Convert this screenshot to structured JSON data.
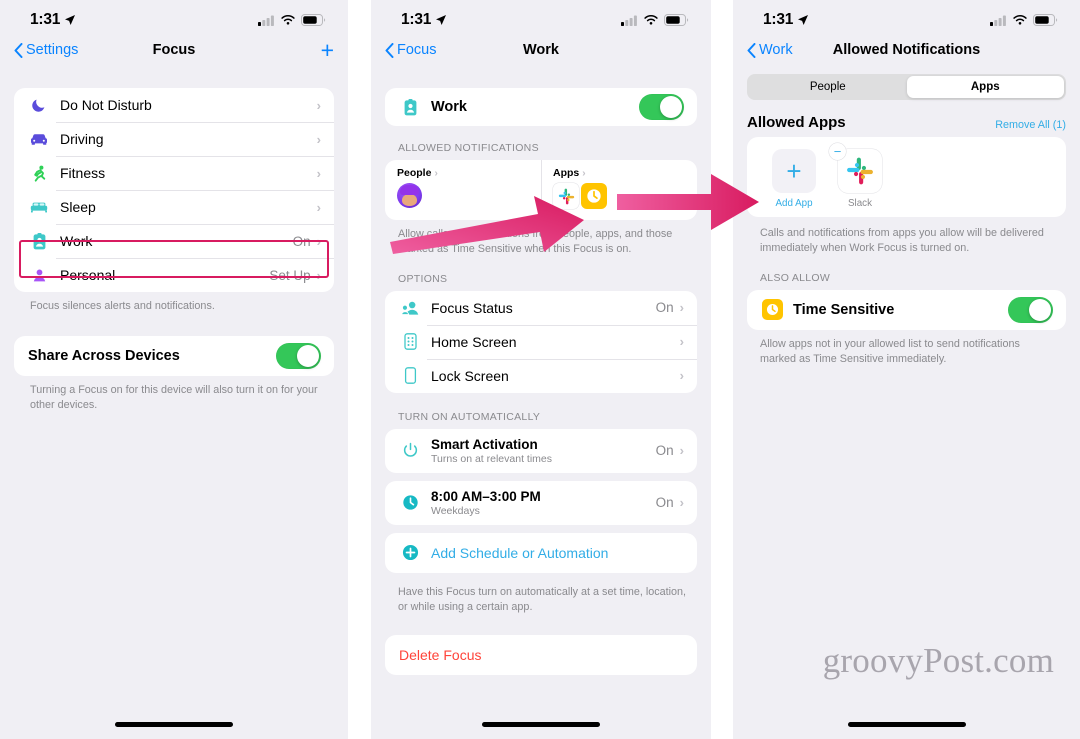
{
  "statusbar": {
    "time": "1:31",
    "location_icon": "location-arrow-icon",
    "cellular_icon": "cellular-bars-icon",
    "wifi_icon": "wifi-icon",
    "battery_icon": "battery-icon"
  },
  "watermark": "groovyPost.com",
  "colors": {
    "accent_blue": "#0a84ff",
    "accent_teal": "#32ade6",
    "toggle_green": "#34c759",
    "danger_red": "#ff443a",
    "highlight_pink": "#d81b60",
    "arrow_pink": "#e8357f"
  },
  "panel1": {
    "nav": {
      "back_label": "Settings",
      "title": "Focus",
      "add_icon": "plus-icon"
    },
    "focus_list": [
      {
        "icon": "moon-icon",
        "label": "Do Not Disturb",
        "value": "",
        "chevron": "›"
      },
      {
        "icon": "car-icon",
        "label": "Driving",
        "value": "",
        "chevron": "›"
      },
      {
        "icon": "running-person-icon",
        "label": "Fitness",
        "value": "",
        "chevron": "›"
      },
      {
        "icon": "bed-icon",
        "label": "Sleep",
        "value": "",
        "chevron": "›"
      },
      {
        "icon": "id-badge-icon",
        "label": "Work",
        "value": "On",
        "chevron": "›"
      },
      {
        "icon": "person-icon",
        "label": "Personal",
        "value": "Set Up",
        "chevron": "›"
      }
    ],
    "focus_footnote": "Focus silences alerts and notifications.",
    "share": {
      "label": "Share Across Devices",
      "enabled": true
    },
    "share_footnote": "Turning a Focus on for this device will also turn it on for your other devices."
  },
  "panel2": {
    "nav": {
      "back_label": "Focus",
      "title": "Work"
    },
    "work_toggle": {
      "icon": "id-badge-icon",
      "label": "Work",
      "enabled": true
    },
    "allowed_header": "ALLOWED NOTIFICATIONS",
    "allowed_people": {
      "title": "People",
      "chevron": "›",
      "avatar": "memoji-avatar"
    },
    "allowed_apps": {
      "title": "Apps",
      "chevron": "›",
      "icons": [
        "slack-icon",
        "time-sensitive-clock-icon"
      ]
    },
    "allowed_footnote": "Allow calls and notifications from people, apps, and those marked as Time Sensitive when this Focus is on.",
    "options_header": "OPTIONS",
    "options": [
      {
        "icon": "focus-status-icon",
        "label": "Focus Status",
        "value": "On",
        "chevron": "›"
      },
      {
        "icon": "home-screen-icon",
        "label": "Home Screen",
        "value": "",
        "chevron": "›"
      },
      {
        "icon": "lock-screen-icon",
        "label": "Lock Screen",
        "value": "",
        "chevron": "›"
      }
    ],
    "auto_header": "TURN ON AUTOMATICALLY",
    "automations": [
      {
        "icon": "power-icon",
        "label": "Smart Activation",
        "sub": "Turns on at relevant times",
        "value": "On",
        "chevron": "›"
      },
      {
        "icon": "clock-icon",
        "label": "8:00 AM–3:00 PM",
        "sub": "Weekdays",
        "value": "On",
        "chevron": "›"
      }
    ],
    "add_schedule": {
      "icon": "plus-circle-icon",
      "label": "Add Schedule or Automation"
    },
    "auto_footnote": "Have this Focus turn on automatically at a set time, location, or while using a certain app.",
    "delete": {
      "label": "Delete Focus"
    }
  },
  "panel3": {
    "nav": {
      "back_label": "Work",
      "title": "Allowed Notifications"
    },
    "segments": [
      {
        "label": "People",
        "active": false
      },
      {
        "label": "Apps",
        "active": true
      }
    ],
    "section": {
      "title": "Allowed Apps",
      "action": "Remove All (1)"
    },
    "apps": [
      {
        "tile": "add",
        "icon": "plus-icon",
        "caption": "Add App",
        "badge": ""
      },
      {
        "tile": "app",
        "icon": "slack-icon",
        "caption": "Slack",
        "badge": "minus-badge-icon"
      }
    ],
    "apps_footnote": "Calls and notifications from apps you allow will be delivered immediately when Work Focus is turned on.",
    "also_allow_header": "ALSO ALLOW",
    "time_sensitive": {
      "icon": "time-sensitive-clock-icon",
      "label": "Time Sensitive",
      "enabled": true
    },
    "ts_footnote": "Allow apps not in your allowed list to send notifications marked as Time Sensitive immediately."
  }
}
